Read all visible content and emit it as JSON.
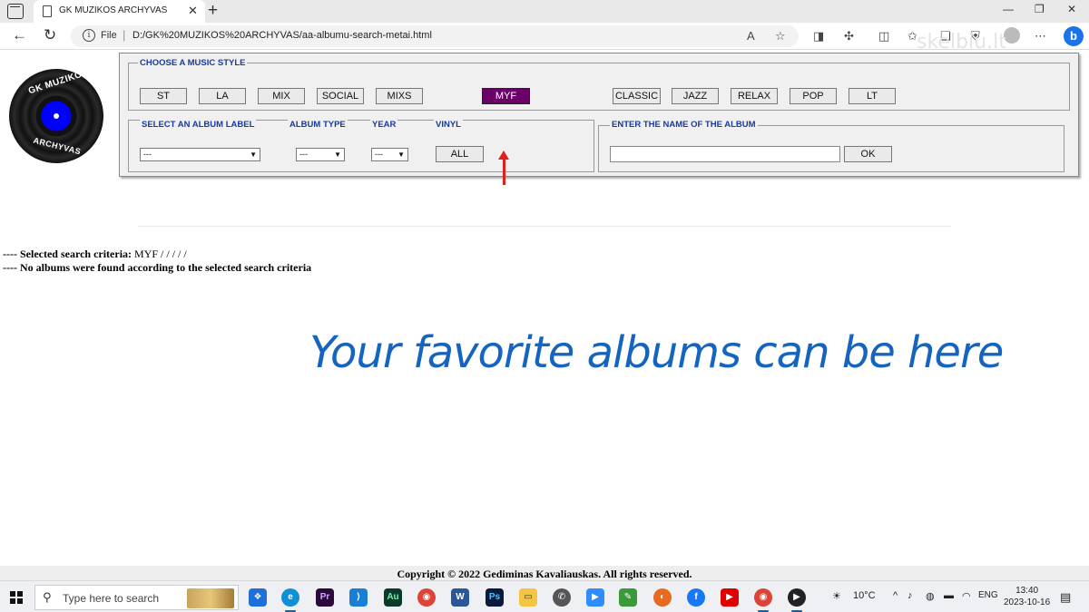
{
  "browser": {
    "tab_title": "GK MUZIKOS ARCHYVAS",
    "url_scheme_label": "File",
    "url": "D:/GK%20MUZIKOS%20ARCHYVAS/aa-albumu-search-metai.html",
    "watermark": "skelbiu.lt"
  },
  "logo": {
    "top_text": "GK MUZIKOS",
    "bottom_text": "ARCHYVAS"
  },
  "styles": {
    "legend": "CHOOSE A MUSIC STYLE",
    "buttons": [
      "ST",
      "LA",
      "MIX",
      "SOCIAL",
      "MIXS",
      "MYF",
      "CLASSIC",
      "JAZZ",
      "RELAX",
      "POP",
      "LT"
    ],
    "active": "MYF"
  },
  "filters": {
    "label_legend": "SELECT AN ALBUM LABEL",
    "type_legend": "ALBUM TYPE",
    "year_legend": "YEAR",
    "vinyl_legend": "VINYL",
    "label_value": "---",
    "type_value": "---",
    "year_value": "---",
    "vinyl_button": "ALL"
  },
  "album_search": {
    "legend": "ENTER THE NAME OF THE ALBUM",
    "value": "",
    "ok_button": "OK"
  },
  "results": {
    "criteria_prefix": "---- ",
    "criteria_label": "Selected search criteria:",
    "criteria_value": " MYF / / / / /",
    "none_found": "---- No albums were found according to the selected search criteria"
  },
  "banner": "Your favorite albums can be here",
  "footer": "Copyright © 2022 Gediminas Kavaliauskas. All rights reserved.",
  "taskbar": {
    "search_placeholder": "Type here to search",
    "weather": "10°C",
    "language": "ENG",
    "time": "13:40",
    "date": "2023-10-16"
  },
  "colors": {
    "active_style": "#6b006b",
    "legend_text": "#1a3a9a",
    "banner_text": "#1565c0",
    "arrow": "#e0201c"
  }
}
